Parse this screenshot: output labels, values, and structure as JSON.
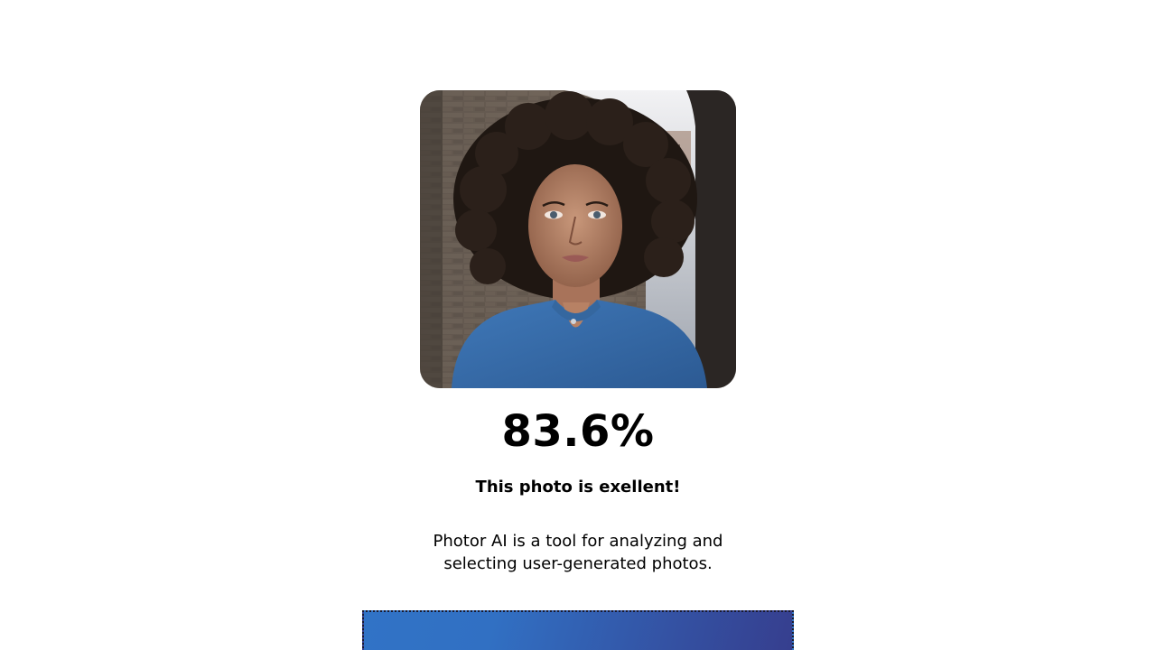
{
  "result": {
    "score": "83.6%",
    "verdict": "This photo is exellent!",
    "description": "Photor AI is a tool for analyzing and selecting user-generated photos."
  },
  "photo": {
    "subject": "portrait-photo"
  },
  "colors": {
    "text": "#000000",
    "background": "#ffffff",
    "button_gradient_start": "#3173c6",
    "button_gradient_end": "#363e8e"
  }
}
